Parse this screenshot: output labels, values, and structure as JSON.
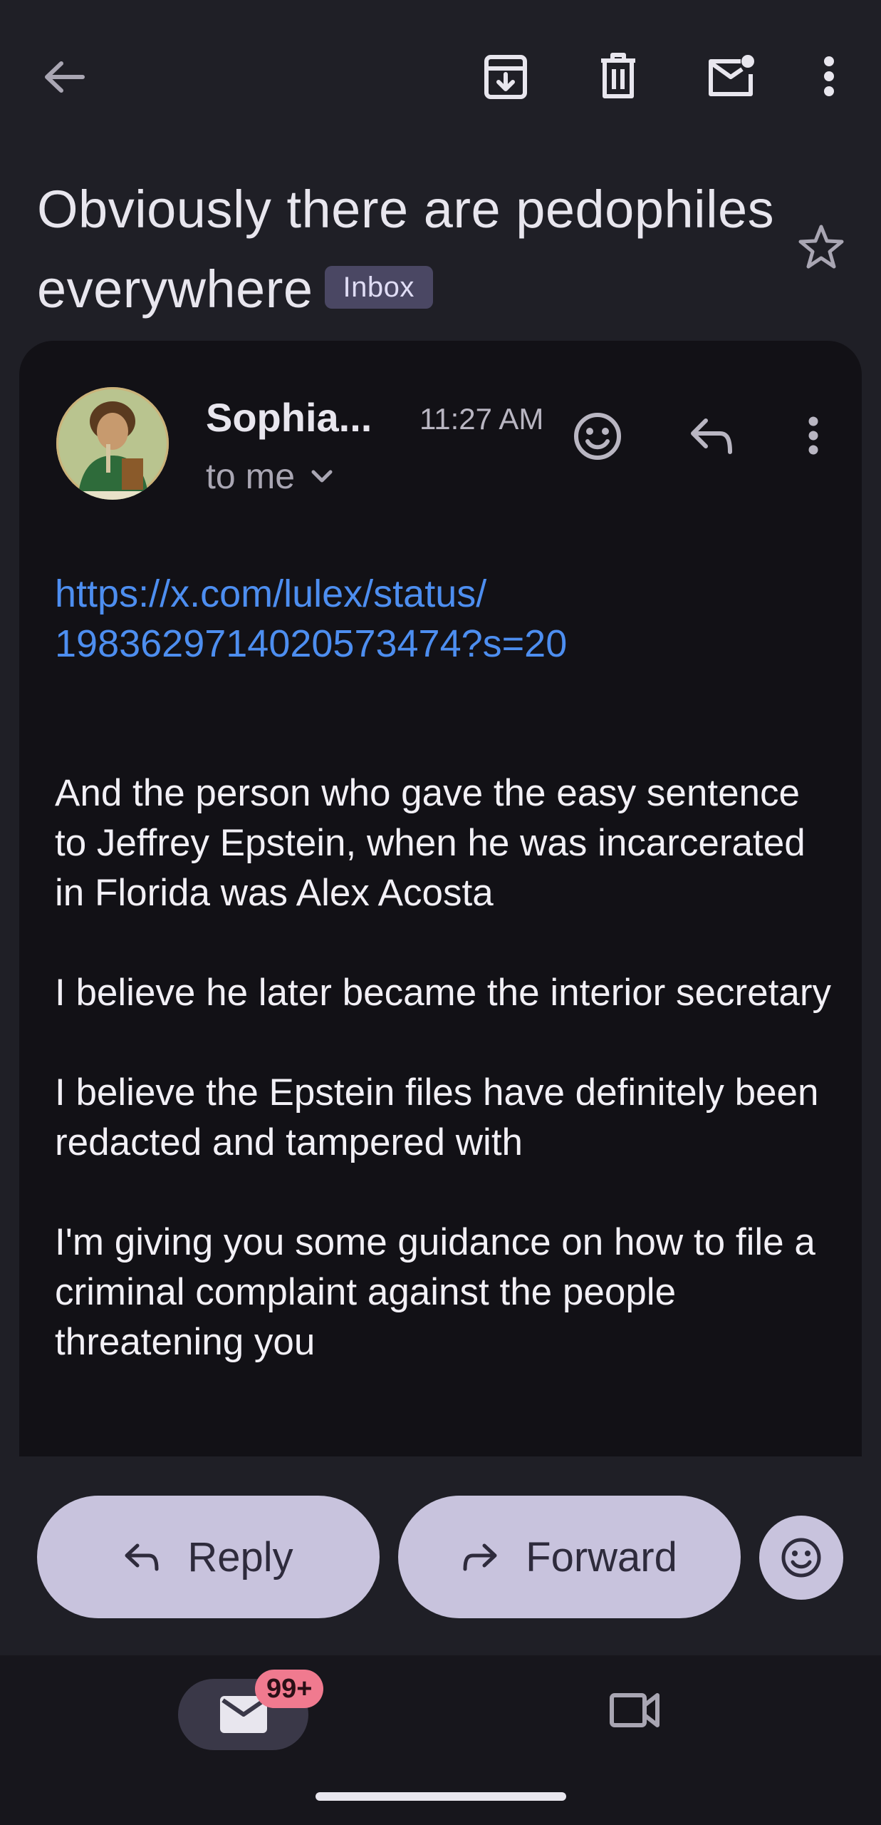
{
  "topbar": {
    "back_icon": "arrow-left-icon",
    "archive_icon": "archive-icon",
    "delete_icon": "trash-icon",
    "mark_unread_icon": "mail-unread-icon",
    "more_icon": "more-vertical-icon"
  },
  "subject": {
    "text": "Obviously there are pedophiles everywhere",
    "label": "Inbox"
  },
  "message": {
    "sender": "Sophia...",
    "time": "11:27 AM",
    "recipient": "to me",
    "link": "https://x.com/lulex/status/1983629714020573474?s=20",
    "link_line1": "https://x.com/lulex/status/",
    "link_line2": "1983629714020573474?s=20",
    "paragraphs": [
      "And the person who gave the easy sentence to Jeffrey Epstein, when he was incarcerated in Florida was Alex Acosta",
      "I believe he later became the interior secretary",
      "I believe the Epstein files have definitely been redacted and tampered with",
      "I'm giving you some guidance on how to file a criminal complaint against the people threatening you"
    ]
  },
  "actions": {
    "reply_label": "Reply",
    "forward_label": "Forward"
  },
  "bottom_nav": {
    "mail_badge": "99+"
  },
  "colors": {
    "background": "#1f1f26",
    "card": "#121116",
    "link": "#4d8ef0",
    "pill": "#c8c3dd",
    "badge": "#f07a8f"
  }
}
